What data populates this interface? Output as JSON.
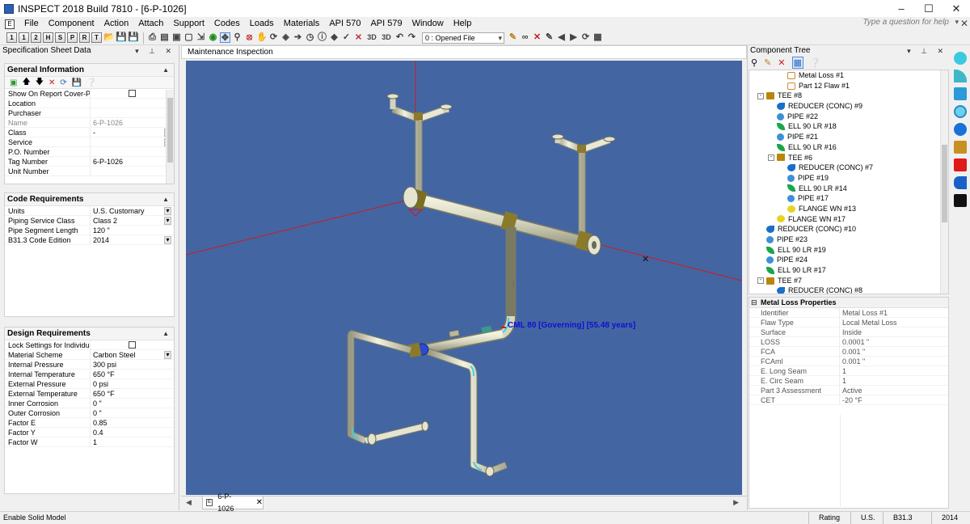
{
  "window": {
    "title": "INSPECT 2018 Build 7810 - [6-P-1026]"
  },
  "menu": [
    "File",
    "Component",
    "Action",
    "Attach",
    "Support",
    "Codes",
    "Loads",
    "Materials",
    "API 570",
    "API 579",
    "Window",
    "Help"
  ],
  "help_search_placeholder": "Type a question for help",
  "toolbar": {
    "file_combo": "0 : Opened File"
  },
  "left_panel": {
    "title": "Specification Sheet Data",
    "general": {
      "title": "General Information",
      "rows": [
        {
          "k": "Show On Report Cover-Page",
          "v": ""
        },
        {
          "k": "Location",
          "v": ""
        },
        {
          "k": "Purchaser",
          "v": ""
        },
        {
          "k": "Name",
          "v": "6-P-1026"
        },
        {
          "k": "Class",
          "v": "-"
        },
        {
          "k": "Service",
          "v": ""
        },
        {
          "k": "P.O. Number",
          "v": ""
        },
        {
          "k": "Tag Number",
          "v": "6-P-1026"
        },
        {
          "k": "Unit Number",
          "v": ""
        }
      ]
    },
    "code": {
      "title": "Code Requirements",
      "rows": [
        {
          "k": "Units",
          "v": "U.S. Customary"
        },
        {
          "k": "Piping Service Class",
          "v": "Class 2"
        },
        {
          "k": "Pipe Segment Length",
          "v": "120 \""
        },
        {
          "k": "B31.3 Code Edition",
          "v": "2014"
        }
      ]
    },
    "design": {
      "title": "Design Requirements",
      "rows": [
        {
          "k": "Lock Settings for Individual...",
          "v": ""
        },
        {
          "k": "Material Scheme",
          "v": "Carbon Steel"
        },
        {
          "k": "Internal Pressure",
          "v": "300 psi"
        },
        {
          "k": "Internal Temperature",
          "v": "650 °F"
        },
        {
          "k": "External Pressure",
          "v": "0 psi"
        },
        {
          "k": "External Temperature",
          "v": "650 °F"
        },
        {
          "k": "Inner Corrosion",
          "v": "0 \""
        },
        {
          "k": "Outer Corrosion",
          "v": "0 \""
        },
        {
          "k": "Factor E",
          "v": "0.85"
        },
        {
          "k": "Factor Y",
          "v": "0.4"
        },
        {
          "k": "Factor W",
          "v": "1"
        }
      ]
    }
  },
  "center": {
    "doc_title": "Maintenance Inspection",
    "cml_label": "CML 80 [Governing] [55.48 years]",
    "tab_label": "6-P-1026"
  },
  "right_panel": {
    "title": "Component Tree",
    "tree": [
      {
        "label": "Metal Loss #1",
        "icon": "metal",
        "indent": 3,
        "exp": ""
      },
      {
        "label": "Part 12 Flaw #1",
        "icon": "part",
        "indent": 3,
        "exp": ""
      },
      {
        "label": "TEE #8",
        "icon": "tee",
        "indent": 1,
        "exp": "-"
      },
      {
        "label": "REDUCER (CONC) #9",
        "icon": "reducer",
        "indent": 2,
        "exp": ""
      },
      {
        "label": "PIPE #22",
        "icon": "pipe",
        "indent": 2,
        "exp": ""
      },
      {
        "label": "ELL 90 LR #18",
        "icon": "ell",
        "indent": 2,
        "exp": ""
      },
      {
        "label": "PIPE #21",
        "icon": "pipe",
        "indent": 2,
        "exp": ""
      },
      {
        "label": "ELL 90 LR #16",
        "icon": "ell",
        "indent": 2,
        "exp": ""
      },
      {
        "label": "TEE #6",
        "icon": "tee",
        "indent": 2,
        "exp": "-"
      },
      {
        "label": "REDUCER (CONC) #7",
        "icon": "reducer",
        "indent": 3,
        "exp": ""
      },
      {
        "label": "PIPE #19",
        "icon": "pipe",
        "indent": 3,
        "exp": ""
      },
      {
        "label": "ELL 90 LR #14",
        "icon": "ell",
        "indent": 3,
        "exp": ""
      },
      {
        "label": "PIPE #17",
        "icon": "pipe",
        "indent": 3,
        "exp": ""
      },
      {
        "label": "FLANGE WN #13",
        "icon": "flange",
        "indent": 3,
        "exp": ""
      },
      {
        "label": "FLANGE WN #17",
        "icon": "flange",
        "indent": 2,
        "exp": ""
      },
      {
        "label": "REDUCER (CONC) #10",
        "icon": "reducer",
        "indent": 1,
        "exp": ""
      },
      {
        "label": "PIPE #23",
        "icon": "pipe",
        "indent": 1,
        "exp": ""
      },
      {
        "label": "ELL 90 LR #19",
        "icon": "ell",
        "indent": 1,
        "exp": ""
      },
      {
        "label": "PIPE #24",
        "icon": "pipe",
        "indent": 1,
        "exp": ""
      },
      {
        "label": "ELL 90 LR #17",
        "icon": "ell",
        "indent": 1,
        "exp": ""
      },
      {
        "label": "TEE #7",
        "icon": "tee",
        "indent": 1,
        "exp": "-"
      },
      {
        "label": "REDUCER (CONC) #8",
        "icon": "reducer",
        "indent": 2,
        "exp": ""
      }
    ],
    "props": {
      "title": "Metal Loss Properties",
      "rows": [
        {
          "k": "Identifier",
          "v": "Metal Loss #1"
        },
        {
          "k": "Flaw Type",
          "v": "Local Metal Loss"
        },
        {
          "k": "Surface",
          "v": "Inside"
        },
        {
          "k": "LOSS",
          "v": "0.0001 \""
        },
        {
          "k": "FCA",
          "v": "0.001 \""
        },
        {
          "k": "FCAml",
          "v": "0.001 \""
        },
        {
          "k": "E. Long Seam",
          "v": "1"
        },
        {
          "k": "E. Circ Seam",
          "v": "1"
        },
        {
          "k": "Part 3 Assessment",
          "v": "Active"
        },
        {
          "k": "CET",
          "v": "-20 °F"
        }
      ]
    }
  },
  "status": {
    "message": "Enable Solid Model",
    "rating": "Rating",
    "units": "U.S.",
    "code": "B31.3",
    "year": "2014"
  },
  "colors": {
    "viewport_bg": "#4366a3",
    "pipe": "#d8d8c0",
    "fitting": "#8a7a2a",
    "axis": "#d11a1a",
    "cml_label": "#1010d0"
  }
}
